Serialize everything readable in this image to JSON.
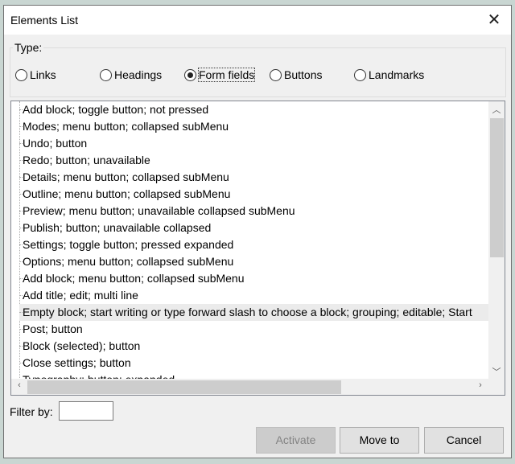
{
  "dialog": {
    "title": "Elements List"
  },
  "type_group": {
    "label": "Type:",
    "options": [
      {
        "label": "Links",
        "selected": false
      },
      {
        "label": "Headings",
        "selected": false
      },
      {
        "label": "Form fields",
        "selected": true
      },
      {
        "label": "Buttons",
        "selected": false
      },
      {
        "label": "Landmarks",
        "selected": false
      }
    ]
  },
  "list": {
    "items": [
      "Add block; toggle button; not pressed",
      "Modes; menu button; collapsed subMenu",
      "Undo; button",
      "Redo; button; unavailable",
      "Details; menu button; collapsed subMenu",
      "Outline; menu button; collapsed subMenu",
      "Preview; menu button; unavailable collapsed subMenu",
      "Publish; button; unavailable collapsed",
      "Settings; toggle button; pressed expanded",
      "Options; menu button; collapsed subMenu",
      "Add block; menu button; collapsed subMenu",
      "Add title; edit; multi line",
      "Empty block; start writing or type forward slash to choose a block; grouping; editable; Start",
      "Post; button",
      "Block (selected); button",
      "Close settings; button",
      "Typography; button; expanded"
    ],
    "selected_index": 12
  },
  "filter": {
    "label": "Filter by:",
    "value": ""
  },
  "buttons": {
    "activate": "Activate",
    "move_to": "Move to",
    "cancel": "Cancel"
  }
}
